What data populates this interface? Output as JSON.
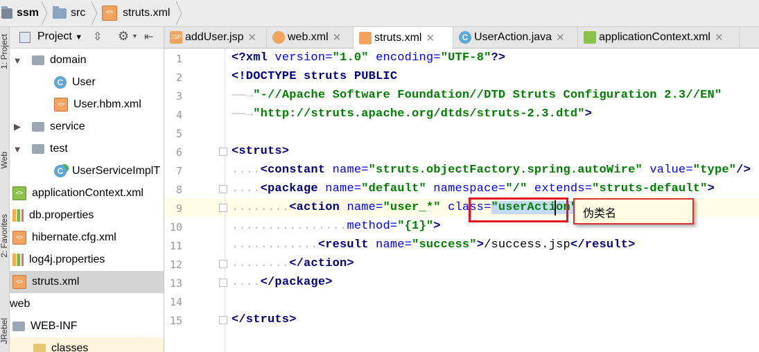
{
  "breadcrumb": {
    "items": [
      "ssm",
      "src",
      "struts.xml"
    ]
  },
  "left_stripe": {
    "labels": [
      "1: Project",
      "Web",
      "2: Favorites",
      "JRebel"
    ]
  },
  "project_panel": {
    "view_selector": "Project",
    "tree": [
      {
        "label": "domain",
        "type": "folder",
        "expanded": true
      },
      {
        "label": "User",
        "type": "class"
      },
      {
        "label": "User.hbm.xml",
        "type": "xml"
      },
      {
        "label": "service",
        "type": "folder",
        "expanded": false
      },
      {
        "label": "test",
        "type": "folder",
        "expanded": true
      },
      {
        "label": "UserServiceImplT",
        "type": "class"
      },
      {
        "label": "applicationContext.xml",
        "type": "xml"
      },
      {
        "label": "db.properties",
        "type": "props"
      },
      {
        "label": "hibernate.cfg.xml",
        "type": "xml"
      },
      {
        "label": "log4j.properties",
        "type": "props"
      },
      {
        "label": "struts.xml",
        "type": "xml",
        "selected": true
      },
      {
        "label": "web",
        "type": "plain"
      },
      {
        "label": "WEB-INF",
        "type": "folder"
      },
      {
        "label": "classes",
        "type": "folder"
      }
    ]
  },
  "tabs": [
    {
      "label": "addUser.jsp",
      "icon": "jsp-icon"
    },
    {
      "label": "web.xml",
      "icon": "web-xml-icon"
    },
    {
      "label": "struts.xml",
      "icon": "xml-icon",
      "active": true
    },
    {
      "label": "UserAction.java",
      "icon": "class-icon"
    },
    {
      "label": "applicationContext.xml",
      "icon": "spring-xml-icon"
    }
  ],
  "code_lines": [
    {
      "n": "1",
      "text": "<?xml version=\"1.0\" encoding=\"UTF-8\"?>"
    },
    {
      "n": "2",
      "text": "<!DOCTYPE struts PUBLIC"
    },
    {
      "n": "3",
      "text": "\"-//Apache Software Foundation//DTD Struts Configuration 2.3//EN\""
    },
    {
      "n": "4",
      "text": "\"http://struts.apache.org/dtds/struts-2.3.dtd\">"
    },
    {
      "n": "5",
      "text": ""
    },
    {
      "n": "6",
      "text": "<struts>"
    },
    {
      "n": "7",
      "text": "<constant name=\"struts.objectFactory.spring.autoWire\" value=\"type\"/>"
    },
    {
      "n": "8",
      "text": "<package name=\"default\" namespace=\"/\" extends=\"struts-default\">"
    },
    {
      "n": "9",
      "text": "<action name=\"user_*\" class=\"userAction\""
    },
    {
      "n": "10",
      "text": "method=\"{1}\">"
    },
    {
      "n": "11",
      "text": "<result name=\"success\">/success.jsp</result>"
    },
    {
      "n": "12",
      "text": "</action>"
    },
    {
      "n": "13",
      "text": "</package>"
    },
    {
      "n": "14",
      "text": ""
    },
    {
      "n": "15",
      "text": "</struts>"
    }
  ],
  "annotation": {
    "note": "伪类名"
  }
}
